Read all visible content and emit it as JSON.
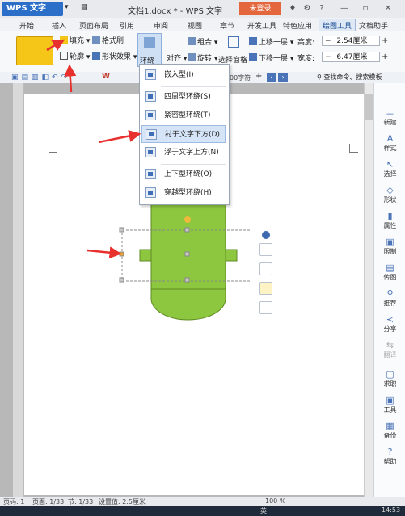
{
  "title_bar": {
    "app_name": "WPS 文字",
    "document_title": "文档1.docx * - WPS 文字",
    "login_label": "未登录",
    "icons": [
      "skin-icon",
      "settings-icon",
      "help-icon",
      "minimize-icon",
      "restore-icon",
      "close-icon"
    ]
  },
  "tabs": [
    {
      "label": "开始"
    },
    {
      "label": "插入"
    },
    {
      "label": "页面布局"
    },
    {
      "label": "引用"
    },
    {
      "label": "审阅"
    },
    {
      "label": "视图"
    },
    {
      "label": "章节"
    },
    {
      "label": "开发工具"
    },
    {
      "label": "特色应用"
    },
    {
      "label": "绘图工具",
      "active": true
    },
    {
      "label": "文档助手"
    }
  ],
  "ribbon": {
    "fill_label": "填充",
    "format_brush_label": "格式刷",
    "outline_label": "轮廓",
    "shape_effect_label": "形状效果",
    "wrap_label": "环绕",
    "align_label": "对齐",
    "group_label": "组合",
    "rotate_label": "旋转",
    "selection_pane_label": "选择窗格",
    "bring_forward_label": "上移一层",
    "send_backward_label": "下移一层",
    "height_label": "高度:",
    "height_value": "2.54厘米",
    "width_label": "宽度:",
    "width_value": "6.47厘米"
  },
  "quick_bar": {
    "char_count": "00字符",
    "search_placeholder": "查找命令、搜索模板"
  },
  "wrap_menu": {
    "items": [
      {
        "label": "嵌入型(I)"
      },
      {
        "label": "四周型环绕(S)"
      },
      {
        "label": "紧密型环绕(T)"
      },
      {
        "label": "衬于文字下方(D)",
        "highlighted": true
      },
      {
        "label": "浮于文字上方(N)"
      },
      {
        "label": "上下型环绕(O)"
      },
      {
        "label": "穿越型环绕(H)"
      }
    ]
  },
  "right_panel": [
    {
      "label": "新建",
      "icon": "new-icon"
    },
    {
      "label": "样式",
      "icon": "style-icon"
    },
    {
      "label": "选择",
      "icon": "select-icon"
    },
    {
      "label": "形状",
      "icon": "shape-icon"
    },
    {
      "label": "属性",
      "icon": "property-icon"
    },
    {
      "label": "限制",
      "icon": "restrict-icon"
    },
    {
      "label": "传图",
      "icon": "upload-image-icon"
    },
    {
      "label": "推荐",
      "icon": "recommend-icon"
    },
    {
      "label": "分享",
      "icon": "share-icon"
    },
    {
      "label": "翻译",
      "icon": "translate-icon"
    },
    {
      "label": "求职",
      "icon": "job-icon"
    },
    {
      "label": "工具",
      "icon": "tools-icon"
    },
    {
      "label": "备份",
      "icon": "backup-icon"
    },
    {
      "label": "帮助",
      "icon": "help-icon"
    }
  ],
  "status_bar": {
    "page_num": "页码: 1",
    "pages": "页面: 1/33",
    "section": "节: 1/33",
    "setting": "设置值: 2.5厘米",
    "zoom": "100 %"
  },
  "taskbar": {
    "ime": "英",
    "time": "14:53"
  },
  "colors": {
    "shape_fill": "#8dc63f",
    "accent_red": "#e8312f",
    "ribbon_active": "#1b4f96"
  }
}
